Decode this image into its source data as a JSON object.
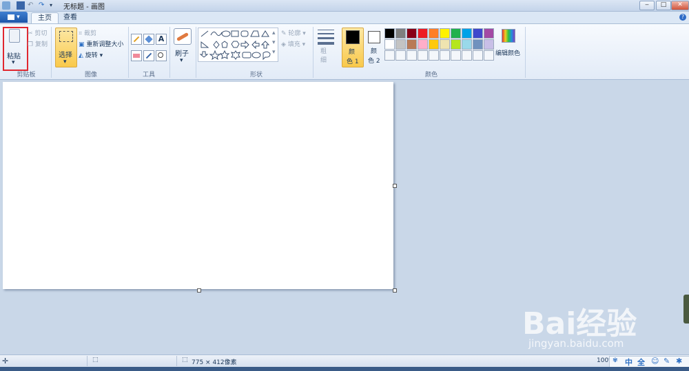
{
  "window": {
    "title": "无标题 - 画图",
    "minimize": "‒",
    "maximize": "□",
    "close": "✕"
  },
  "menu": {
    "app_menu": "▾"
  },
  "tabs": [
    {
      "label": "主页"
    },
    {
      "label": "查看"
    }
  ],
  "help": "?",
  "ribbon": {
    "clipboard": {
      "paste": "粘贴",
      "cut": "剪切",
      "copy": "复制",
      "label": "剪贴板"
    },
    "image": {
      "select": "选择",
      "crop": "裁剪",
      "resize": "重新调整大小",
      "rotate": "旋转",
      "label": "图像"
    },
    "tools": {
      "text_icon": "A",
      "label": "工具"
    },
    "brushes": {
      "label": "刷子"
    },
    "shapes": {
      "outline": "轮廓",
      "fill": "填充",
      "label": "形状"
    },
    "size": {
      "label": "粗\n细"
    },
    "colors": {
      "color1_l1": "颜",
      "color1_l2": "色 1",
      "color2_l1": "颜",
      "color2_l2": "色 2",
      "edit": "编辑颜色",
      "label": "颜色",
      "color1_value": "#000000",
      "color2_value": "#ffffff",
      "palette_row1": [
        "#000000",
        "#7f7f7f",
        "#880015",
        "#ed1c24",
        "#ff7f27",
        "#fff200",
        "#22b14c",
        "#00a2e8",
        "#3f48cc",
        "#a349a4"
      ],
      "palette_row2": [
        "#ffffff",
        "#c3c3c3",
        "#b97a57",
        "#ffaec9",
        "#ffc90e",
        "#efe4b0",
        "#b5e61d",
        "#99d9ea",
        "#7092be",
        "#c8bfe7"
      ]
    }
  },
  "status": {
    "dimensions": "775 × 412像素",
    "zoom": "100%",
    "ime": "中",
    "ime2": "全"
  },
  "watermark": {
    "main": "Bai经验",
    "sub": "jingyan.baidu.com"
  }
}
